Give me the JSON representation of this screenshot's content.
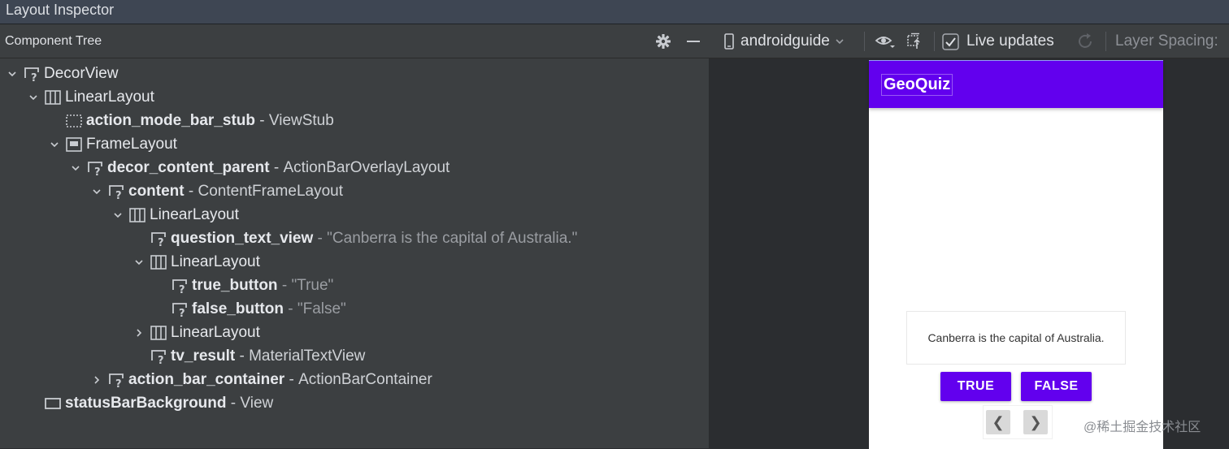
{
  "window": {
    "title": "Layout Inspector"
  },
  "component_tree": {
    "header": "Component Tree",
    "nodes": [
      {
        "name": "DecorView",
        "bold": false,
        "type": "",
        "quoted": "",
        "icon": "unknown-view-icon",
        "expand": "expanded"
      },
      {
        "name": "LinearLayout",
        "bold": false,
        "type": "",
        "quoted": "",
        "icon": "linear-layout-icon",
        "expand": "expanded"
      },
      {
        "name": "action_mode_bar_stub",
        "bold": true,
        "type": "ViewStub",
        "quoted": "",
        "icon": "view-stub-icon",
        "expand": "none"
      },
      {
        "name": "FrameLayout",
        "bold": false,
        "type": "",
        "quoted": "",
        "icon": "frame-layout-icon",
        "expand": "expanded"
      },
      {
        "name": "decor_content_parent",
        "bold": true,
        "type": "ActionBarOverlayLayout",
        "quoted": "",
        "icon": "unknown-view-icon",
        "expand": "expanded"
      },
      {
        "name": "content",
        "bold": true,
        "type": "ContentFrameLayout",
        "quoted": "",
        "icon": "unknown-view-icon",
        "expand": "expanded"
      },
      {
        "name": "LinearLayout",
        "bold": false,
        "type": "",
        "quoted": "",
        "icon": "linear-layout-icon",
        "expand": "expanded"
      },
      {
        "name": "question_text_view",
        "bold": true,
        "type": "",
        "quoted": "\"Canberra is the capital of Australia.\"",
        "icon": "unknown-view-icon",
        "expand": "none"
      },
      {
        "name": "LinearLayout",
        "bold": false,
        "type": "",
        "quoted": "",
        "icon": "linear-layout-icon",
        "expand": "expanded"
      },
      {
        "name": "true_button",
        "bold": true,
        "type": "",
        "quoted": "\"True\"",
        "icon": "unknown-view-icon",
        "expand": "none"
      },
      {
        "name": "false_button",
        "bold": true,
        "type": "",
        "quoted": "\"False\"",
        "icon": "unknown-view-icon",
        "expand": "none"
      },
      {
        "name": "LinearLayout",
        "bold": false,
        "type": "",
        "quoted": "",
        "icon": "linear-layout-icon",
        "expand": "collapsed"
      },
      {
        "name": "tv_result",
        "bold": true,
        "type": "MaterialTextView",
        "quoted": "",
        "icon": "unknown-view-icon",
        "expand": "none"
      },
      {
        "name": "action_bar_container",
        "bold": true,
        "type": "ActionBarContainer",
        "quoted": "",
        "icon": "unknown-view-icon",
        "expand": "collapsed"
      },
      {
        "name": "statusBarBackground",
        "bold": true,
        "type": "View",
        "quoted": "",
        "icon": "view-icon",
        "expand": "none"
      }
    ]
  },
  "toolbar": {
    "device": "androidguide",
    "live_updates_label": "Live updates",
    "live_updates_checked": true,
    "layer_spacing_label": "Layer Spacing:"
  },
  "preview": {
    "app_title": "GeoQuiz",
    "question": "Canberra is the capital of Australia.",
    "true_label": "TRUE",
    "false_label": "FALSE",
    "prev_glyph": "❮",
    "next_glyph": "❯"
  },
  "watermark": "@稀土掘金技术社区",
  "colors": {
    "accent": "#6200ee",
    "panel": "#3c3f41",
    "background": "#2b2d30"
  }
}
